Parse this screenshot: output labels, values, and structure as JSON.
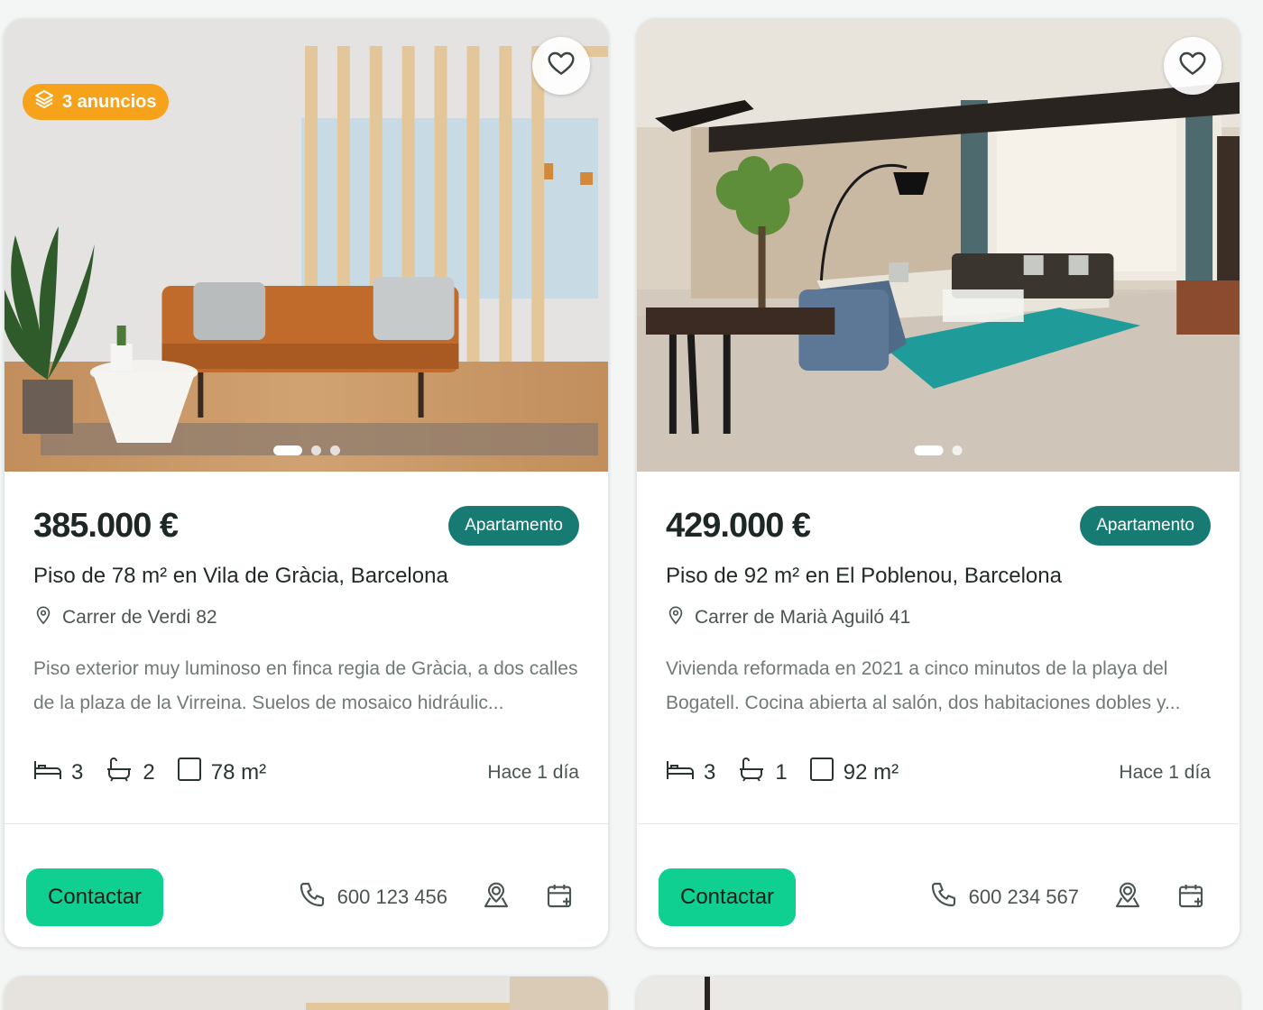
{
  "listings": [
    {
      "badge_label": "3 anuncios",
      "price": "385.000 €",
      "type": "Apartamento",
      "title": "Piso de 78 m² en Vila de Gràcia, Barcelona",
      "address": "Carrer de Verdi 82",
      "description": "Piso exterior muy luminoso en finca regia de Gràcia, a dos calles de la plaza de la Virreina. Suelos de mosaico hidráulic...",
      "bedrooms": "3",
      "bathrooms": "2",
      "area": "78 m²",
      "age": "Hace 1 día",
      "contact_label": "Contactar",
      "phone": "600 123 456",
      "photo_count": 3,
      "photo_active": 0
    },
    {
      "price": "429.000 €",
      "type": "Apartamento",
      "title": "Piso de 92 m² en El Poblenou, Barcelona",
      "address": "Carrer de Marià Aguiló 41",
      "description": "Vivienda reformada en 2021 a cinco minutos de la playa del Bogatell. Cocina abierta al salón, dos habitaciones dobles y...",
      "bedrooms": "3",
      "bathrooms": "1",
      "area": "92 m²",
      "age": "Hace 1 día",
      "contact_label": "Contactar",
      "phone": "600 234 567",
      "photo_count": 2,
      "photo_active": 0
    }
  ],
  "icons": {
    "favorite": "heart-outline-icon",
    "badge": "layers-icon",
    "location": "map-pin-icon",
    "bedrooms": "bed-icon",
    "bathrooms": "bathtub-icon",
    "area": "square-icon",
    "phone": "phone-icon",
    "map_person": "map-user-icon",
    "calendar": "calendar-plus-icon"
  },
  "colors": {
    "badge": "#f7a21b",
    "type_pill": "#177a73",
    "contact_button": "#0fcf91",
    "price": "#1d2826"
  }
}
